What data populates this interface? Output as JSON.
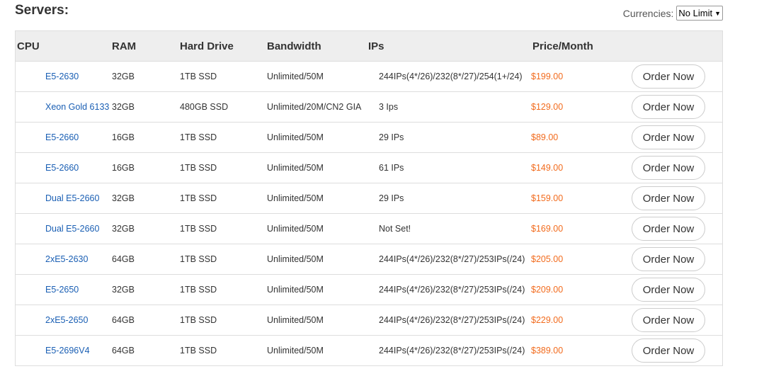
{
  "title": "Servers:",
  "currency": {
    "label": "Currencies:",
    "selected": "No Limit"
  },
  "headers": {
    "cpu": "CPU",
    "ram": "RAM",
    "hard_drive": "Hard Drive",
    "bandwidth": "Bandwidth",
    "ips": "IPs",
    "price": "Price/Month"
  },
  "colors": {
    "link": "#1a5fb4",
    "price": "#f26b1d",
    "header_bg": "#eeeeee"
  },
  "servers": [
    {
      "cpu": "E5-2630",
      "ram": "32GB",
      "hd": "1TB SSD",
      "bw": "Unlimited/50M",
      "ips": "244IPs(4*/26)/232(8*/27)/254(1+/24)",
      "price": "$199.00",
      "order": "Order Now"
    },
    {
      "cpu": "Xeon Gold 6133",
      "ram": "32GB",
      "hd": "480GB SSD",
      "bw": "Unlimited/20M/CN2 GIA",
      "ips": "3 Ips",
      "price": "$129.00",
      "order": "Order Now"
    },
    {
      "cpu": "E5-2660",
      "ram": "16GB",
      "hd": "1TB SSD",
      "bw": "Unlimited/50M",
      "ips": "29 IPs",
      "price": "$89.00",
      "order": "Order Now"
    },
    {
      "cpu": "E5-2660",
      "ram": "16GB",
      "hd": "1TB SSD",
      "bw": "Unlimited/50M",
      "ips": "61 IPs",
      "price": "$149.00",
      "order": "Order Now"
    },
    {
      "cpu": "Dual E5-2660",
      "ram": "32GB",
      "hd": "1TB SSD",
      "bw": "Unlimited/50M",
      "ips": "29 IPs",
      "price": "$159.00",
      "order": "Order Now"
    },
    {
      "cpu": "Dual E5-2660",
      "ram": "32GB",
      "hd": "1TB SSD",
      "bw": "Unlimited/50M",
      "ips": "Not Set!",
      "price": "$169.00",
      "order": "Order Now"
    },
    {
      "cpu": "2xE5-2630",
      "ram": "64GB",
      "hd": "1TB SSD",
      "bw": "Unlimited/50M",
      "ips": "244IPs(4*/26)/232(8*/27)/253IPs(/24)",
      "price": "$205.00",
      "order": "Order Now"
    },
    {
      "cpu": "E5-2650",
      "ram": "32GB",
      "hd": "1TB SSD",
      "bw": "Unlimited/50M",
      "ips": "244IPs(4*/26)/232(8*/27)/253IPs(/24)",
      "price": "$209.00",
      "order": "Order Now"
    },
    {
      "cpu": "2xE5-2650",
      "ram": "64GB",
      "hd": "1TB SSD",
      "bw": "Unlimited/50M",
      "ips": "244IPs(4*/26)/232(8*/27)/253IPs(/24)",
      "price": "$229.00",
      "order": "Order Now"
    },
    {
      "cpu": "E5-2696V4",
      "ram": "64GB",
      "hd": "1TB SSD",
      "bw": "Unlimited/50M",
      "ips": "244IPs(4*/26)/232(8*/27)/253IPs(/24)",
      "price": "$389.00",
      "order": "Order Now"
    }
  ]
}
